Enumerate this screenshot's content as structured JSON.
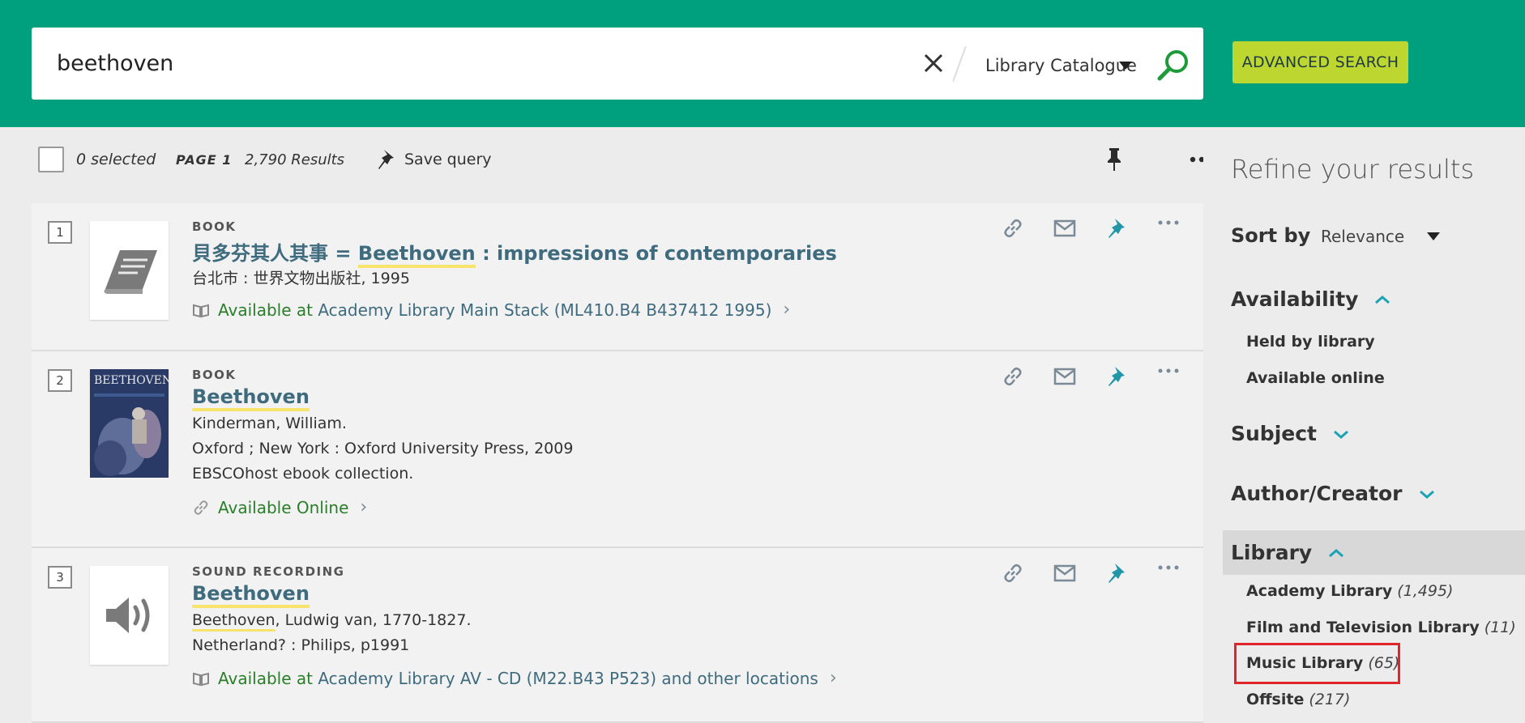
{
  "search": {
    "query": "beethoven",
    "scope": "Library Catalogue",
    "advanced_label": "ADVANCED SEARCH"
  },
  "toolbar": {
    "selected": "0 selected",
    "page": "PAGE 1",
    "results": "2,790 Results",
    "save_query": "Save query"
  },
  "results": [
    {
      "num": "1",
      "type": "BOOK",
      "title_pre": "貝多芬其人其事 = ",
      "title_hl": "Beethoven",
      "title_post": " : impressions of contemporaries",
      "line1": "台北市 : 世界文物出版社, 1995",
      "avail_status": "Available at",
      "avail_detail": "Academy Library  Main Stack (ML410.B4 B437412 1995)"
    },
    {
      "num": "2",
      "type": "BOOK",
      "title_hl": "Beethoven",
      "line1": "Kinderman, William.",
      "line2": "Oxford ; New York : Oxford University Press, 2009",
      "line3": "EBSCOhost ebook collection.",
      "avail_status": "Available Online",
      "cover_text": "BEETHOVEN"
    },
    {
      "num": "3",
      "type": "SOUND RECORDING",
      "title_hl": "Beethoven",
      "line1_hl": "Beethoven",
      "line1_rest": ", Ludwig van, 1770-1827.",
      "line2": "Netherland? : Philips, p1991",
      "avail_status": "Available at",
      "avail_detail": "Academy Library  AV - CD (M22.B43 P523) and other locations"
    }
  ],
  "sidebar": {
    "refine": "Refine your results",
    "sort_by": "Sort by",
    "sort_value": "Relevance",
    "availability": "Availability",
    "availability_items": [
      "Held by library",
      "Available online"
    ],
    "subject": "Subject",
    "author": "Author/Creator",
    "library": "Library",
    "library_items": [
      {
        "name": "Academy Library",
        "count": "(1,495)"
      },
      {
        "name": "Film and Television Library",
        "count": "(11)"
      },
      {
        "name": "Music Library",
        "count": "(65)"
      },
      {
        "name": "Offsite",
        "count": "(217)"
      }
    ]
  },
  "colors": {
    "header": "#00a07f",
    "advanced": "#bed730",
    "link": "#3f6b7e",
    "available": "#2a7e2a",
    "pin": "#2196a8",
    "highlight_box": "#e0262a"
  }
}
